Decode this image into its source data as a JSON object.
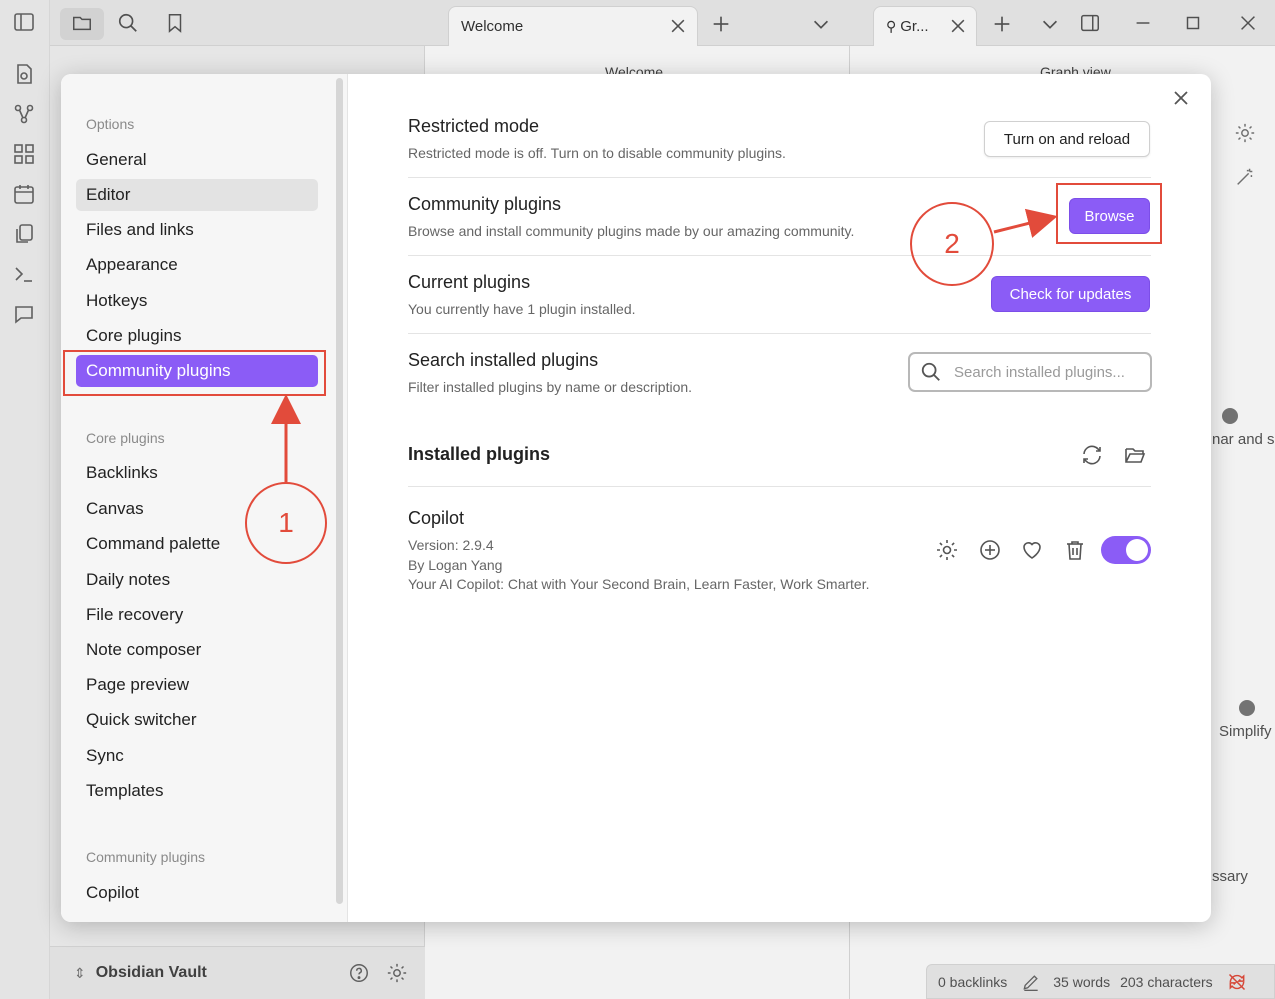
{
  "background": {
    "tabs": {
      "welcome_tab": "Welcome",
      "graph_tab": "Gr..."
    },
    "middle_header": "Welcome",
    "right_header": "Graph view",
    "vault_name": "Obsidian Vault",
    "status": {
      "backlinks": "0 backlinks",
      "words": "35 words",
      "characters": "203 characters"
    },
    "graph_labels": [
      "nar and sp",
      "Simplify",
      "ssary"
    ]
  },
  "settings": {
    "sidebar": {
      "options_group": "Options",
      "options_items": [
        "General",
        "Editor",
        "Files and links",
        "Appearance",
        "Hotkeys",
        "Core plugins",
        "Community plugins"
      ],
      "core_group": "Core plugins",
      "core_items": [
        "Backlinks",
        "Canvas",
        "Command palette",
        "Daily notes",
        "File recovery",
        "Note composer",
        "Page preview",
        "Quick switcher",
        "Sync",
        "Templates"
      ],
      "community_group": "Community plugins",
      "community_items": [
        "Copilot"
      ]
    },
    "restricted_mode": {
      "name": "Restricted mode",
      "desc": "Restricted mode is off. Turn on to disable community plugins.",
      "button": "Turn on and reload"
    },
    "community_plugins": {
      "name": "Community plugins",
      "desc": "Browse and install community plugins made by our amazing community.",
      "button": "Browse"
    },
    "current_plugins": {
      "name": "Current plugins",
      "desc": "You currently have 1 plugin installed.",
      "button": "Check for updates"
    },
    "search_plugins": {
      "name": "Search installed plugins",
      "desc": "Filter installed plugins by name or description.",
      "placeholder": "Search installed plugins..."
    },
    "installed_heading": "Installed plugins",
    "plugin": {
      "name": "Copilot",
      "version": "Version: 2.9.4",
      "author": "By Logan Yang",
      "description": "Your AI Copilot: Chat with Your Second Brain, Learn Faster, Work Smarter.",
      "enabled": true
    }
  },
  "annotations": {
    "step1": "1",
    "step2": "2",
    "color": "#e24b3b"
  },
  "colors": {
    "accent": "#8b5cf6"
  }
}
